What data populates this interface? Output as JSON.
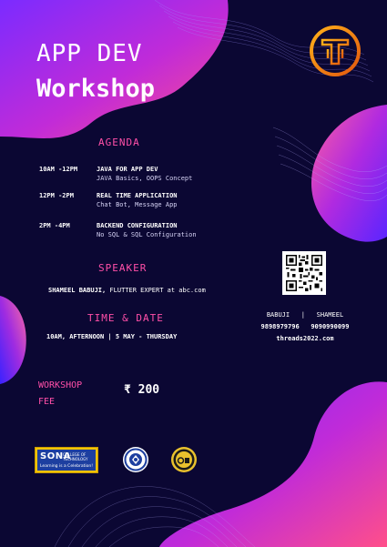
{
  "header": {
    "line1": "APP DEV",
    "line2": "Workshop"
  },
  "agenda": {
    "heading": "AGENDA",
    "items": [
      {
        "time": "10AM -12PM",
        "title": "JAVA FOR APP DEV",
        "detail": "JAVA Basics, OOPS Concept"
      },
      {
        "time": "12PM -2PM",
        "title": "REAL TIME APPLICATION",
        "detail": "Chat Bot, Message App"
      },
      {
        "time": "2PM -4PM",
        "title": "BACKEND CONFIGURATION",
        "detail": "No SQL & SQL Configuration"
      }
    ]
  },
  "speaker": {
    "heading": "SPEAKER",
    "name": "SHAMEEL BABUJI,",
    "role": " FLUTTER EXPERT at abc.com"
  },
  "time_date": {
    "heading": "TIME & DATE",
    "line": "10AM, AFTERNOON | 5 MAY - THURSDAY"
  },
  "fee": {
    "label_1": "WORKSHOP",
    "label_2": "FEE",
    "value": "₹ 200"
  },
  "contact": {
    "name_1": "BABUJI",
    "separator": "|",
    "name_2": "SHAMEEL",
    "phone_1": "9898979796",
    "phone_2": "9090990099",
    "website": "threads2022.com"
  },
  "sponsors": {
    "sona_name": "SONA",
    "sona_college_1": "COLLEGE OF",
    "sona_college_2": "TECHNOLOGY",
    "sona_tagline": "Learning is a Celebration!"
  },
  "colors": {
    "background": "#0b0733",
    "accent_pink": "#ff4fa8",
    "accent_purple": "#6a2cff",
    "logo_orange": "#f28c1a"
  },
  "icons": [
    "threads-logo-icon",
    "qr-code-icon",
    "college-emblem-icon",
    "department-emblem-icon"
  ]
}
